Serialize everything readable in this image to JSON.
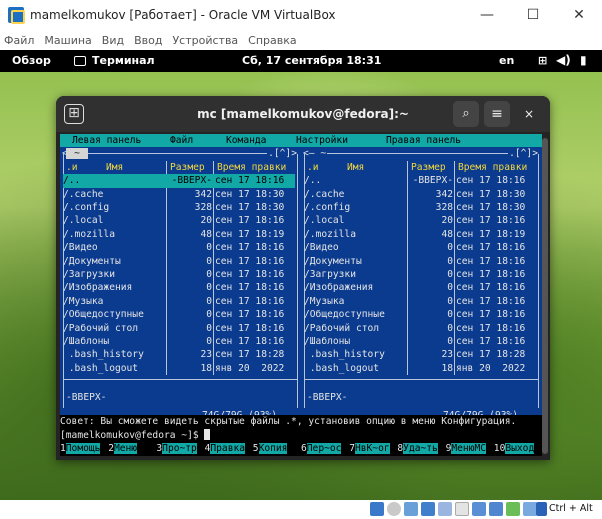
{
  "vbox": {
    "title": "mamelkomukov [Работает] - Oracle VM VirtualBox",
    "controls": {
      "minimize": "—",
      "maximize": "☐",
      "close": "✕"
    },
    "menu": [
      "Файл",
      "Машина",
      "Вид",
      "Ввод",
      "Устройства",
      "Справка"
    ],
    "host_key": "Ctrl + Alt"
  },
  "gnome": {
    "overview": "Обзор",
    "app": "Терминал",
    "clock": "Сб, 17 сентября 18:31",
    "lang": "en",
    "icons": {
      "network": "network-icon",
      "volume": "volume-icon",
      "power": "power-icon"
    }
  },
  "terminal": {
    "title": "mc [mamelkomukov@fedora]:~",
    "newtab": "⊞",
    "search": "⌕",
    "menu": "≡",
    "close": "×"
  },
  "mc": {
    "menubar": [
      "Левая панель",
      "Файл",
      "Команда",
      "Настройки",
      "Правая панель"
    ],
    "columns": {
      "name": "Имя",
      "sort": ".и",
      "size": "Размер",
      "time": "Время правки"
    },
    "corner_left": ".[^]>",
    "corner_right": ".[^]>",
    "tilde": "~",
    "left_arrow": "<",
    "right_prefix": "<— ~",
    "left": {
      "files": [
        {
          "name": "/..",
          "size": "-ВВЕРХ-",
          "time": "сен 17 18:16"
        },
        {
          "name": "/.cache",
          "size": "342",
          "time": "сен 17 18:30"
        },
        {
          "name": "/.config",
          "size": "328",
          "time": "сен 17 18:30"
        },
        {
          "name": "/.local",
          "size": "20",
          "time": "сен 17 18:16"
        },
        {
          "name": "/.mozilla",
          "size": "48",
          "time": "сен 17 18:19"
        },
        {
          "name": "/Видео",
          "size": "0",
          "time": "сен 17 18:16"
        },
        {
          "name": "/Документы",
          "size": "0",
          "time": "сен 17 18:16"
        },
        {
          "name": "/Загрузки",
          "size": "0",
          "time": "сен 17 18:16"
        },
        {
          "name": "/Изображения",
          "size": "0",
          "time": "сен 17 18:16"
        },
        {
          "name": "/Музыка",
          "size": "0",
          "time": "сен 17 18:16"
        },
        {
          "name": "/Общедоступные",
          "size": "0",
          "time": "сен 17 18:16"
        },
        {
          "name": "/Рабочий стол",
          "size": "0",
          "time": "сен 17 18:16"
        },
        {
          "name": "/Шаблоны",
          "size": "0",
          "time": "сен 17 18:16"
        },
        {
          "name": " .bash_history",
          "size": "23",
          "time": "сен 17 18:28"
        },
        {
          "name": " .bash_logout",
          "size": "18",
          "time": "янв 20  2022"
        }
      ],
      "footer": "-ВВЕРХ-",
      "disk": "74G/79G (93%)"
    },
    "right": {
      "files": [
        {
          "name": "/..",
          "size": "-ВВЕРХ-",
          "time": "сен 17 18:16"
        },
        {
          "name": "/.cache",
          "size": "342",
          "time": "сен 17 18:30"
        },
        {
          "name": "/.config",
          "size": "328",
          "time": "сен 17 18:30"
        },
        {
          "name": "/.local",
          "size": "20",
          "time": "сен 17 18:16"
        },
        {
          "name": "/.mozilla",
          "size": "48",
          "time": "сен 17 18:19"
        },
        {
          "name": "/Видео",
          "size": "0",
          "time": "сен 17 18:16"
        },
        {
          "name": "/Документы",
          "size": "0",
          "time": "сен 17 18:16"
        },
        {
          "name": "/Загрузки",
          "size": "0",
          "time": "сен 17 18:16"
        },
        {
          "name": "/Изображения",
          "size": "0",
          "time": "сен 17 18:16"
        },
        {
          "name": "/Музыка",
          "size": "0",
          "time": "сен 17 18:16"
        },
        {
          "name": "/Общедоступные",
          "size": "0",
          "time": "сен 17 18:16"
        },
        {
          "name": "/Рабочий стол",
          "size": "0",
          "time": "сен 17 18:16"
        },
        {
          "name": "/Шаблоны",
          "size": "0",
          "time": "сен 17 18:16"
        },
        {
          "name": " .bash_history",
          "size": "23",
          "time": "сен 17 18:28"
        },
        {
          "name": " .bash_logout",
          "size": "18",
          "time": "янв 20  2022"
        }
      ],
      "footer": "-ВВЕРХ-",
      "disk": "74G/79G (93%)"
    },
    "hint": "Совет: Вы сможете видеть скрытые файлы .*, установив опцию в меню Конфигурация.",
    "prompt": "[mamelkomukov@fedora ~]$ ",
    "fkeys": [
      {
        "n": "1",
        "l": "Помощь"
      },
      {
        "n": "2",
        "l": "Меню"
      },
      {
        "n": "3",
        "l": "Про~тр"
      },
      {
        "n": "4",
        "l": "Правка"
      },
      {
        "n": "5",
        "l": "Копия"
      },
      {
        "n": "6",
        "l": "Пер~ос"
      },
      {
        "n": "7",
        "l": "НвК~ог"
      },
      {
        "n": "8",
        "l": "Уда~ть"
      },
      {
        "n": "9",
        "l": "МенюМС"
      },
      {
        "n": "10",
        "l": "Выход"
      }
    ]
  },
  "colors": {
    "panel_bg": "#0a3b8e",
    "selection": "#11a8a6",
    "header_text": "#f5d63c"
  }
}
